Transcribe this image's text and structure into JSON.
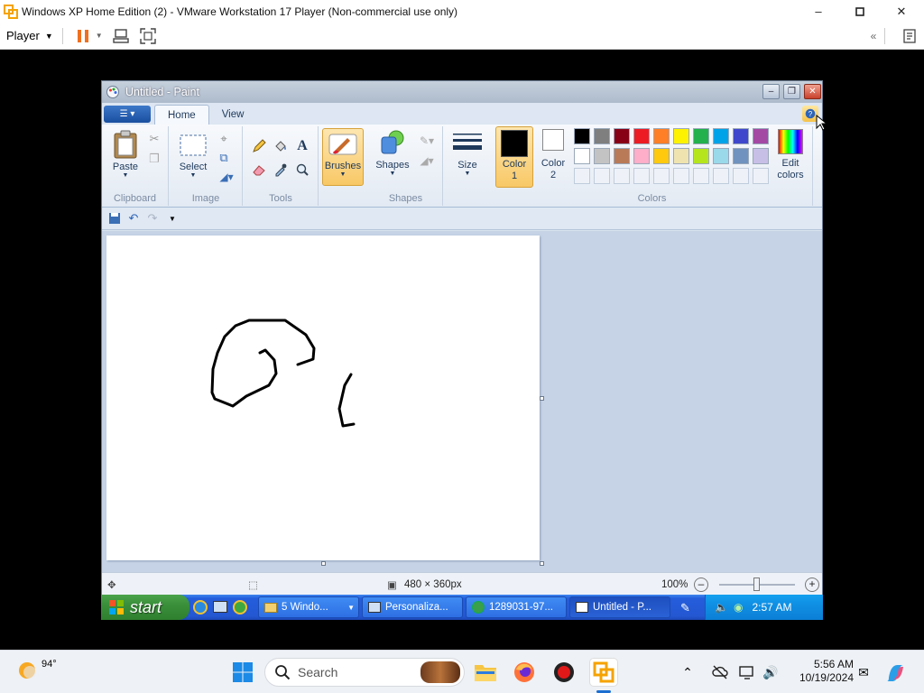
{
  "host": {
    "title": "Windows XP Home Edition (2) - VMware Workstation 17 Player (Non-commercial use only)",
    "player_menu": "Player"
  },
  "paint": {
    "title": "Untitled - Paint",
    "tabs": [
      "Home",
      "View"
    ],
    "groups": {
      "clipboard": "Clipboard",
      "image": "Image",
      "tools": "Tools",
      "shapes": "Shapes",
      "colors": "Colors"
    },
    "buttons": {
      "paste": "Paste",
      "select": "Select",
      "brushes": "Brushes",
      "shapes": "Shapes",
      "size": "Size",
      "color1": "Color 1",
      "color2": "Color 2",
      "edit_colors": "Edit colors"
    },
    "palette_row1": [
      "#000000",
      "#7f7f7f",
      "#880015",
      "#ed1c24",
      "#ff7f27",
      "#fff200",
      "#22b14c",
      "#00a2e8",
      "#3f48cc",
      "#a349a4"
    ],
    "palette_row2": [
      "#ffffff",
      "#c3c3c3",
      "#b97a57",
      "#ffaec9",
      "#ffc90e",
      "#efe4b0",
      "#b5e61d",
      "#99d9ea",
      "#7092be",
      "#c8bfe7"
    ],
    "status": {
      "size": "480 × 360px",
      "zoom": "100%"
    }
  },
  "xp_taskbar": {
    "start": "start",
    "buttons": [
      "5 Windo...",
      "Personaliza...",
      "1289031-97...",
      "Untitled - P..."
    ],
    "clock": "2:57 AM"
  },
  "win11": {
    "weather_temp": "94°",
    "search_placeholder": "Search",
    "time": "5:56 AM",
    "date": "10/19/2024"
  }
}
